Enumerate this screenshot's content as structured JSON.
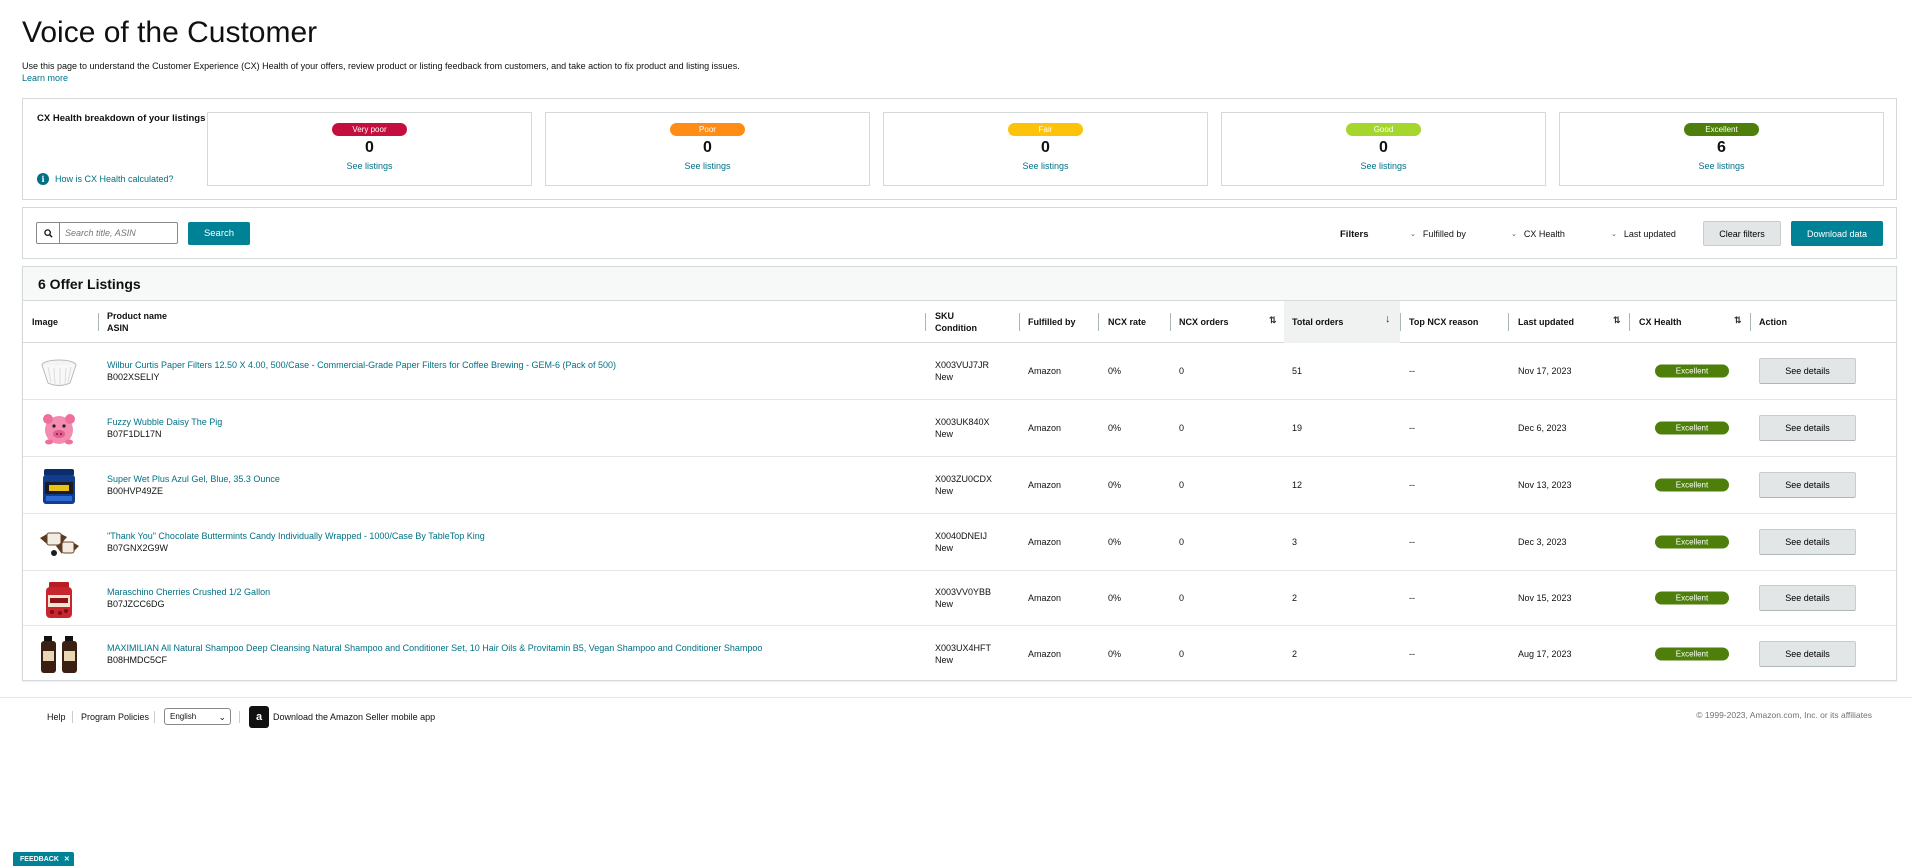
{
  "page": {
    "title": "Voice of the Customer",
    "intro": "Use this page to understand the Customer Experience (CX) Health of your offers, review product or listing feedback from customers, and take action to fix product and listing issues.",
    "learn_more": "Learn more"
  },
  "cx_health": {
    "title": "CX Health breakdown of your listings",
    "help_link": "How is CX Health calculated?",
    "cards": [
      {
        "label": "Very poor",
        "count": "0",
        "link": "See listings",
        "color": "#c40f3e"
      },
      {
        "label": "Poor",
        "count": "0",
        "link": "See listings",
        "color": "#ff8c14"
      },
      {
        "label": "Fair",
        "count": "0",
        "link": "See listings",
        "color": "#fcc30a"
      },
      {
        "label": "Good",
        "count": "0",
        "link": "See listings",
        "color": "#a4d62e"
      },
      {
        "label": "Excellent",
        "count": "6",
        "link": "See listings",
        "color": "#4d7f0a"
      }
    ]
  },
  "toolbar": {
    "search_placeholder": "Search title, ASIN",
    "search_button": "Search",
    "filters_label": "Filters",
    "filter_fulfilled": "Fulfilled by",
    "filter_cx": "CX Health",
    "filter_updated": "Last updated",
    "clear_filters": "Clear filters",
    "download": "Download data"
  },
  "table": {
    "title": "6 Offer Listings",
    "headers": {
      "image": "Image",
      "product_name": "Product name",
      "asin": "ASIN",
      "sku": "SKU",
      "condition": "Condition",
      "fulfilled_by": "Fulfilled by",
      "ncx_rate": "NCX rate",
      "ncx_orders": "NCX orders",
      "total_orders": "Total orders",
      "top_reason": "Top NCX reason",
      "last_updated": "Last updated",
      "cx_health": "CX Health",
      "action": "Action"
    },
    "rows": [
      {
        "name": "Wilbur Curtis Paper Filters 12.50 X 4.00, 500/Case - Commercial-Grade Paper Filters for Coffee Brewing - GEM-6 (Pack of 500)",
        "asin": "B002XSELIY",
        "sku": "X003VUJ7JR",
        "condition": "New",
        "fulfilled": "Amazon",
        "ncx_rate": "0%",
        "ncx_orders": "0",
        "total": "51",
        "reason": "--",
        "updated": "Nov 17, 2023",
        "health": "Excellent",
        "action": "See details",
        "thumb": "coffee-filter"
      },
      {
        "name": "Fuzzy Wubble Daisy The Pig",
        "asin": "B07F1DL17N",
        "sku": "X003UK840X",
        "condition": "New",
        "fulfilled": "Amazon",
        "ncx_rate": "0%",
        "ncx_orders": "0",
        "total": "19",
        "reason": "--",
        "updated": "Dec 6, 2023",
        "health": "Excellent",
        "action": "See details",
        "thumb": "pig-toy"
      },
      {
        "name": "Super Wet Plus Azul Gel, Blue, 35.3 Ounce",
        "asin": "B00HVP49ZE",
        "sku": "X003ZU0CDX",
        "condition": "New",
        "fulfilled": "Amazon",
        "ncx_rate": "0%",
        "ncx_orders": "0",
        "total": "12",
        "reason": "--",
        "updated": "Nov 13, 2023",
        "health": "Excellent",
        "action": "See details",
        "thumb": "gel-jar"
      },
      {
        "name": "\"Thank You\" Chocolate Buttermints Candy Individually Wrapped - 1000/Case By TableTop King",
        "asin": "B07GNX2G9W",
        "sku": "X0040DNEIJ",
        "condition": "New",
        "fulfilled": "Amazon",
        "ncx_rate": "0%",
        "ncx_orders": "0",
        "total": "3",
        "reason": "--",
        "updated": "Dec 3, 2023",
        "health": "Excellent",
        "action": "See details",
        "thumb": "candy"
      },
      {
        "name": "Maraschino Cherries Crushed 1/2 Gallon",
        "asin": "B07JZCC6DG",
        "sku": "X003VV0YBB",
        "condition": "New",
        "fulfilled": "Amazon",
        "ncx_rate": "0%",
        "ncx_orders": "0",
        "total": "2",
        "reason": "--",
        "updated": "Nov 15, 2023",
        "health": "Excellent",
        "action": "See details",
        "thumb": "cherry-jar"
      },
      {
        "name": "MAXIMILIAN All Natural Shampoo Deep Cleansing Natural Shampoo and Conditioner Set, 10 Hair Oils & Provitamin B5, Vegan Shampoo and Conditioner Shampoo",
        "asin": "B08HMDC5CF",
        "sku": "X003UX4HFT",
        "condition": "New",
        "fulfilled": "Amazon",
        "ncx_rate": "0%",
        "ncx_orders": "0",
        "total": "2",
        "reason": "--",
        "updated": "Aug 17, 2023",
        "health": "Excellent",
        "action": "See details",
        "thumb": "shampoo-bottles"
      }
    ]
  },
  "footer": {
    "help": "Help",
    "policies": "Program Policies",
    "language": "English",
    "app_link": "Download the Amazon Seller mobile app",
    "copyright": "© 1999-2023, Amazon.com, Inc. or its affiliates"
  },
  "feedback": {
    "label": "FEEDBACK",
    "close": "✕"
  },
  "colors": {
    "accent": "#008296",
    "link": "#007185",
    "excellent": "#4d7f0a"
  }
}
